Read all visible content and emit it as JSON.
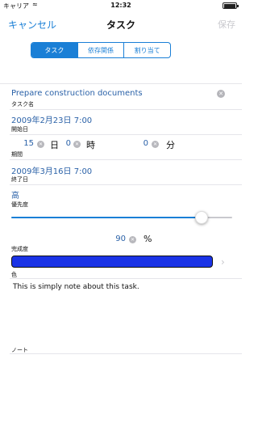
{
  "status": {
    "carrier": "キャリア",
    "time": "12:32"
  },
  "nav": {
    "cancel": "キャンセル",
    "title": "タスク",
    "save": "保存"
  },
  "tabs": [
    "タスク",
    "依存関係",
    "割り当て"
  ],
  "task": {
    "name_value": "Prepare construction documents",
    "name_label": "タスク名",
    "start_value": "2009年2月23日 7:00",
    "start_label": "開始日",
    "period_days": "15",
    "period_days_unit": "日",
    "period_hours": "0",
    "period_hours_unit": "時",
    "period_minutes": "0",
    "period_minutes_unit": "分",
    "period_label": "期間",
    "end_value": "2009年3月16日 7:00",
    "end_label": "終了日",
    "priority_value": "高",
    "priority_label": "優先度",
    "slider_level": 0.86,
    "completion_value": "90",
    "completion_unit": "%",
    "completion_label": "完成度",
    "color_value": "#1a33e6",
    "color_label": "色",
    "note_value": "This is simply note about this task.",
    "note_label": "ノート"
  },
  "colors": {
    "accent": "#1a7fd6",
    "value_text": "#2b62a8",
    "task_color": "#1a33e6"
  }
}
